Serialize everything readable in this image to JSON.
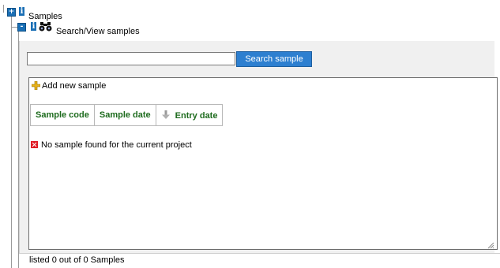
{
  "tree": {
    "root": {
      "label": "Samples",
      "expander": "+",
      "icon": "info-icon"
    },
    "child": {
      "label": "Search/View samples",
      "expander": "-",
      "icon": "info-icon",
      "search_icon": "binoculars-icon"
    }
  },
  "search": {
    "value": "",
    "placeholder": "",
    "button_label": "Search sample"
  },
  "results": {
    "add_label": "Add new sample",
    "columns": [
      "Sample code",
      "Sample date",
      "Entry date"
    ],
    "sorted_column": "Entry date",
    "empty_message": "No sample found for the current project"
  },
  "footer": {
    "status": "listed 0 out of 0 Samples"
  },
  "colors": {
    "accent": "#2d7fd0",
    "tree_icon": "#1a6fb5",
    "header_text": "#1d6b1d",
    "error": "#e01b24",
    "add_icon": "#e8b21a"
  }
}
